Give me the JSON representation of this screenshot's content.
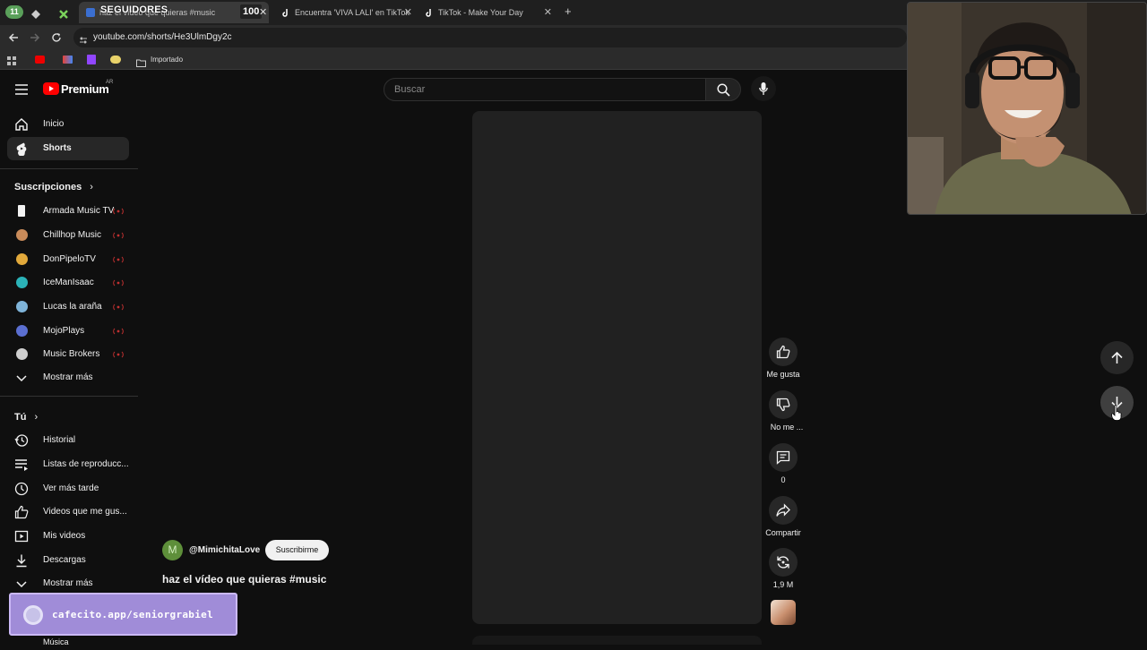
{
  "browser": {
    "tab_group_count": "11",
    "tabs": [
      {
        "title": "haz el vídeo que quieras #music"
      },
      {
        "title": "Encuentra 'VIVA LALI' en TikTok"
      },
      {
        "title": "TikTok - Make Your Day"
      }
    ],
    "overlay_label": "SEGUIDORES",
    "overlay_count": "100",
    "new_tab_label": "+",
    "url": "youtube.com/shorts/He3UlmDgy2c",
    "bookmark_folder": "Importado"
  },
  "header": {
    "logo_text": "Premium",
    "region": "AR",
    "search_placeholder": "Buscar"
  },
  "sidebar": {
    "nav": [
      {
        "label": "Inicio"
      },
      {
        "label": "Shorts"
      }
    ],
    "subscriptions_title": "Suscripciones",
    "subscriptions": [
      {
        "label": "Armada Music TV",
        "color": "#f2f2f2"
      },
      {
        "label": "Chillhop Music",
        "color": "#c98b5a"
      },
      {
        "label": "DonPipeloTV",
        "color": "#e2a93b"
      },
      {
        "label": "IceManIsaac",
        "color": "#2bb3b8"
      },
      {
        "label": "Lucas la araña",
        "color": "#7fb4d9"
      },
      {
        "label": "MojoPlays",
        "color": "#5b6fd1"
      },
      {
        "label": "Music Brokers",
        "color": "#cfcfcf"
      }
    ],
    "show_more": "Mostrar más",
    "you_title": "Tú",
    "you_items": [
      {
        "label": "Historial"
      },
      {
        "label": "Listas de reproducc..."
      },
      {
        "label": "Ver más tarde"
      },
      {
        "label": "Videos que me gus..."
      },
      {
        "label": "Mis videos"
      },
      {
        "label": "Descargas"
      },
      {
        "label": "Mostrar más"
      }
    ],
    "explore_partial": "Música"
  },
  "short": {
    "channel_initial": "M",
    "channel_name": "@MimichitaLove",
    "subscribe_label": "Suscribirme",
    "title": "haz el vídeo que quieras #music",
    "actions": {
      "like": "Me gusta",
      "dislike": "No me ...",
      "comments": "0",
      "share": "Compartir",
      "remix": "1,9 M"
    }
  },
  "overlay": {
    "cafecito": "cafecito.app/seniorgrabiel"
  },
  "colors": {
    "background": "#0f0f0f",
    "youtube_red": "#ff0000",
    "cafecito_bg": "#a08cd8"
  }
}
